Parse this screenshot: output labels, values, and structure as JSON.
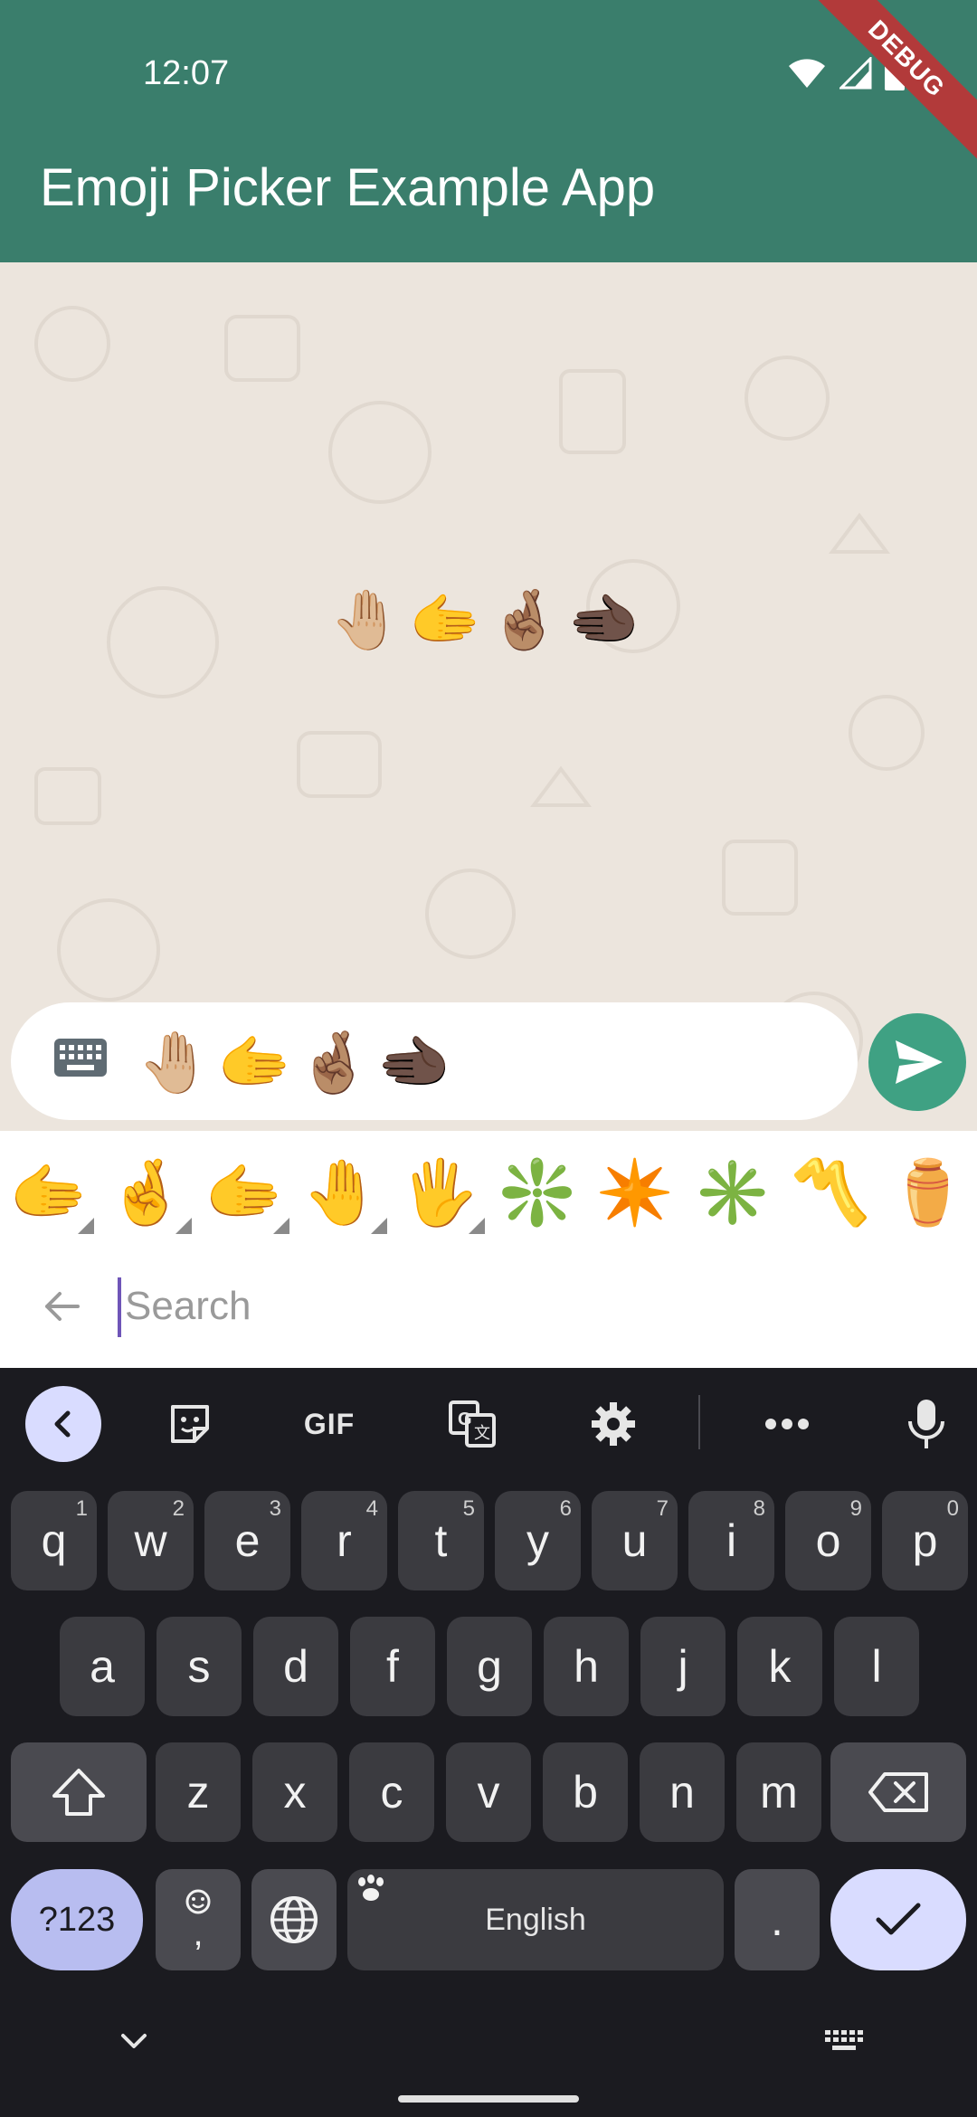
{
  "status_bar": {
    "time": "12:07"
  },
  "debug_banner": "DEBUG",
  "app_bar": {
    "title": "Emoji Picker Example App"
  },
  "chat": {
    "message": "🤚🏼🫱🤞🏽🫲🏿"
  },
  "composer": {
    "text": "🤚🏼🫱🤞🏽🫲🏿"
  },
  "emoji_strip": [
    {
      "emoji": "🫱",
      "has_skin_tones": true
    },
    {
      "emoji": "🤞",
      "has_skin_tones": true
    },
    {
      "emoji": "🫱",
      "has_skin_tones": true
    },
    {
      "emoji": "🤚",
      "has_skin_tones": true
    },
    {
      "emoji": "🖐",
      "has_skin_tones": true
    },
    {
      "emoji": "❇️",
      "has_skin_tones": false
    },
    {
      "emoji": "✴️",
      "has_skin_tones": false
    },
    {
      "emoji": "✳️",
      "has_skin_tones": false
    },
    {
      "emoji": "〽️",
      "has_skin_tones": false
    },
    {
      "emoji": "⚱️",
      "has_skin_tones": false
    }
  ],
  "search": {
    "placeholder": "Search"
  },
  "keyboard": {
    "toolbar": {
      "gif": "GIF"
    },
    "row1": [
      {
        "k": "q",
        "h": "1"
      },
      {
        "k": "w",
        "h": "2"
      },
      {
        "k": "e",
        "h": "3"
      },
      {
        "k": "r",
        "h": "4"
      },
      {
        "k": "t",
        "h": "5"
      },
      {
        "k": "y",
        "h": "6"
      },
      {
        "k": "u",
        "h": "7"
      },
      {
        "k": "i",
        "h": "8"
      },
      {
        "k": "o",
        "h": "9"
      },
      {
        "k": "p",
        "h": "0"
      }
    ],
    "row2": [
      "a",
      "s",
      "d",
      "f",
      "g",
      "h",
      "j",
      "k",
      "l"
    ],
    "row3": [
      "z",
      "x",
      "c",
      "v",
      "b",
      "n",
      "m"
    ],
    "sym_label": "?123",
    "comma_label": ",",
    "space_label": "English",
    "period_label": "."
  },
  "colors": {
    "app_bar": "#3a7e6c",
    "send_button": "#3fa183",
    "keyboard_bg": "#1b1b20",
    "key_bg": "#3b3b40",
    "accent": "#d9dcff"
  },
  "icons": {
    "status": [
      "wifi-icon",
      "signal-icon",
      "battery-icon"
    ],
    "composer": [
      "keyboard-icon",
      "send-icon"
    ],
    "search": [
      "back-arrow-icon"
    ],
    "toolbar": [
      "chevron-left-icon",
      "sticker-icon",
      "translate-icon",
      "gear-icon",
      "more-icon",
      "mic-icon"
    ],
    "keys": [
      "shift-icon",
      "backspace-icon",
      "emoji-icon",
      "globe-icon",
      "check-icon"
    ],
    "nav": [
      "chevron-down-icon",
      "keyboard-switch-icon"
    ]
  }
}
